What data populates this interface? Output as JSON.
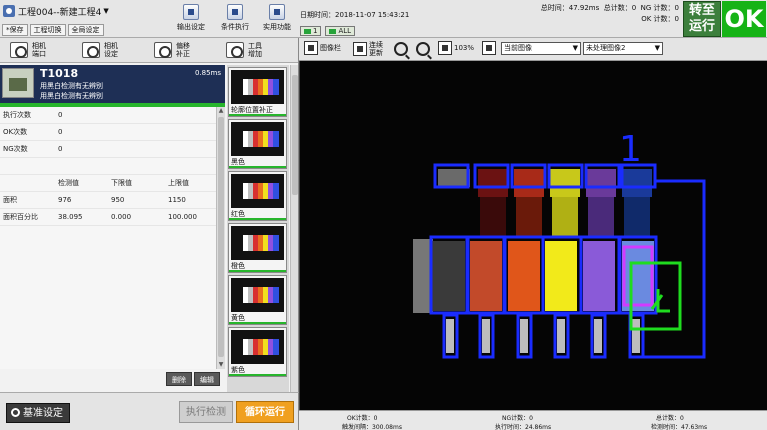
{
  "header": {
    "project": "工程004--新建工程4",
    "mini_buttons": [
      "*保存",
      "工程切换",
      "全局设定"
    ],
    "tools": [
      "输出设定",
      "条件执行",
      "实用功能"
    ],
    "datetime": "日期时间：2018-11-07 15:43:21",
    "flag1": "1",
    "flag2": "ALL",
    "total_time": "总时间：47.92ms",
    "total_count": "总计数：0",
    "ng_count": "NG 计数：0",
    "ok_count": "OK 计数：0",
    "switch_label": "转至运行",
    "ok_label": "OK"
  },
  "left_tools": [
    {
      "l1": "相机",
      "l2": "端口"
    },
    {
      "l1": "相机",
      "l2": "设定"
    },
    {
      "l1": "偏移",
      "l2": "补正"
    },
    {
      "l1": "工具",
      "l2": "增加"
    }
  ],
  "tool": {
    "id": "T1018",
    "time": "0.85ms",
    "name1": "用黑白检测有无辨别",
    "name2": "用黑白检测有无辨别"
  },
  "stats": {
    "exec_label": "执行次数",
    "exec_value": "0",
    "ok_label": "OK次数",
    "ok_value": "0",
    "ng_label": "NG次数",
    "ng_value": "0"
  },
  "measure": {
    "headers": [
      "检测值",
      "下限值",
      "上限值"
    ],
    "rows": [
      {
        "name": "面积",
        "v": "976",
        "low": "950",
        "high": "1150"
      },
      {
        "name": "面积百分比",
        "v": "38.095",
        "low": "0.000",
        "high": "100.000"
      }
    ]
  },
  "actions": {
    "delete": "删除",
    "edit": "编辑"
  },
  "thumbs": [
    "轮廓位置补正",
    "黑色",
    "红色",
    "橙色",
    "黄色",
    "紫色"
  ],
  "bottom": {
    "base": "基准设定",
    "exec": "执行检测",
    "loop": "循环运行"
  },
  "viewer_tools": {
    "layers": "图像栏",
    "refresh1": "连续",
    "refresh2": "更新",
    "zoom": "103%",
    "source": "当前图像",
    "process": "未处理图像2"
  },
  "viewer": {
    "marker": "1"
  },
  "status": {
    "ok": "OK计数：0",
    "trigger": "触发间隔：300.08ms",
    "ng": "NG计数：0",
    "exec_time": "执行时间：24.86ms",
    "total": "总计数：0",
    "detect_time": "检测时间：47.63ms"
  },
  "colors": {
    "accent": "#27b52c",
    "nav": "#1e2f55",
    "box": "#1a2cff",
    "loop": "#f0a020"
  }
}
